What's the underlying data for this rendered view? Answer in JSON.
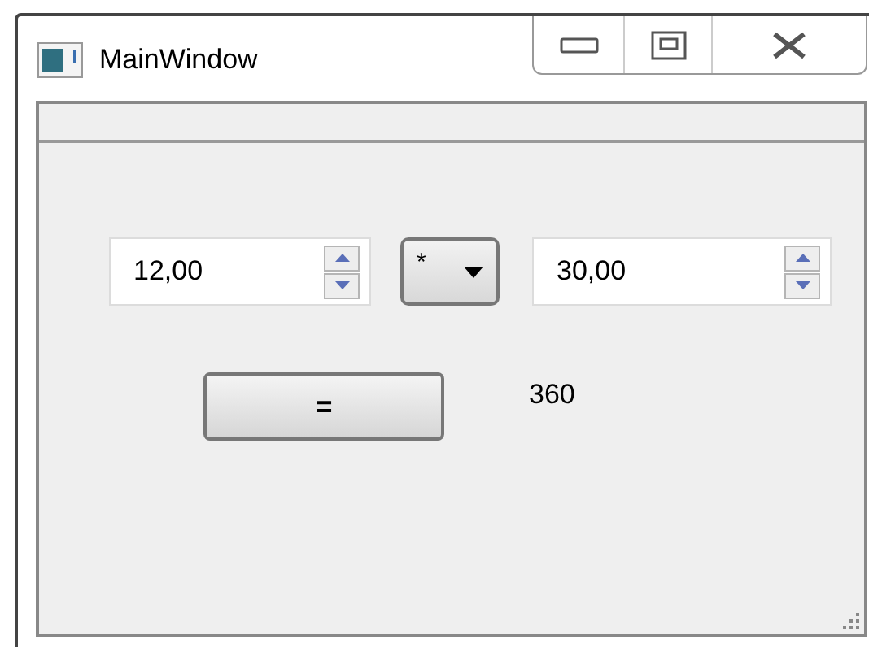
{
  "window": {
    "title": "MainWindow"
  },
  "operand_1": {
    "value": "12,00"
  },
  "operator": {
    "value": "*"
  },
  "operand_2": {
    "value": "30,00"
  },
  "equals_button": {
    "label": "="
  },
  "result": "360"
}
